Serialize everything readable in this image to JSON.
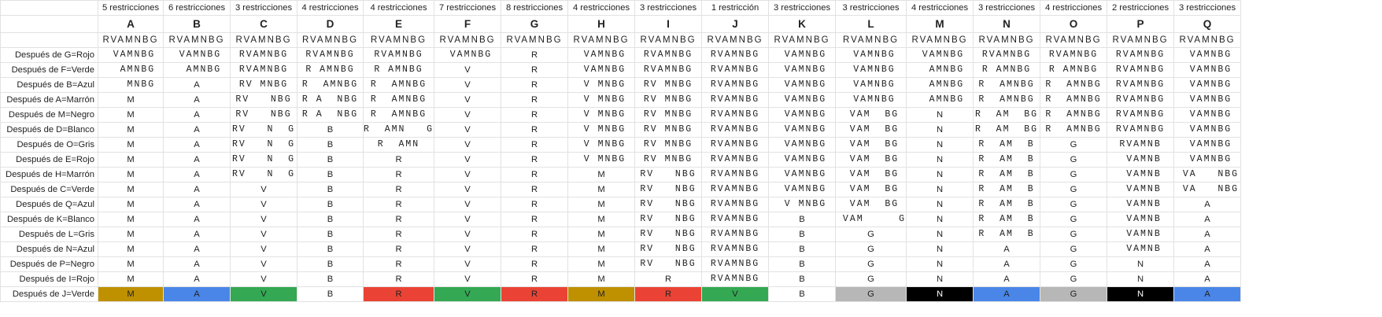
{
  "sheet": {
    "labels_title": "",
    "columns": [
      {
        "count": "5 restricciones",
        "letter": "A"
      },
      {
        "count": "6 restricciones",
        "letter": "B"
      },
      {
        "count": "3 restricciones",
        "letter": "C"
      },
      {
        "count": "4 restricciones",
        "letter": "D"
      },
      {
        "count": "4 restricciones",
        "letter": "E"
      },
      {
        "count": "7 restricciones",
        "letter": "F"
      },
      {
        "count": "8 restricciones",
        "letter": "G"
      },
      {
        "count": "4 restricciones",
        "letter": "H"
      },
      {
        "count": "3 restricciones",
        "letter": "I"
      },
      {
        "count": "1 restricción",
        "letter": "J"
      },
      {
        "count": "3 restricciones",
        "letter": "K"
      },
      {
        "count": "3 restricciones",
        "letter": "L"
      },
      {
        "count": "4 restricciones",
        "letter": "M"
      },
      {
        "count": "3 restricciones",
        "letter": "N"
      },
      {
        "count": "4 restricciones",
        "letter": "O"
      },
      {
        "count": "2 restricciones",
        "letter": "P"
      },
      {
        "count": "3 restricciones",
        "letter": "Q"
      }
    ],
    "options_row": [
      "RVAMNBG",
      "RVAMNBG",
      "RVAMNBG",
      "RVAMNBG",
      "RVAMNBG",
      "RVAMNBG",
      "RVAMNBG",
      "RVAMNBG",
      "RVAMNBG",
      "RVAMNBG",
      "RVAMNBG",
      "RVAMNBG",
      "RVAMNBG",
      "RVAMNBG",
      "RVAMNBG",
      "RVAMNBG",
      "RVAMNBG"
    ],
    "rows": [
      {
        "label": "Después de G=Rojo",
        "cells": [
          " VAMNBG",
          " VAMNBG",
          "RVAMNBG",
          "RVAMNBG",
          "RVAMNBG",
          " VAMNBG",
          "R",
          " VAMNBG",
          "RVAMNBG",
          "RVAMNBG",
          " VAMNBG",
          " VAMNBG",
          " VAMNBG",
          "RVAMNBG",
          "RVAMNBG",
          "RVAMNBG",
          " VAMNBG"
        ]
      },
      {
        "label": "Después de F=Verde",
        "cells": [
          "  AMNBG",
          "  AMNBG",
          "RVAMNBG",
          "R AMNBG",
          "R AMNBG",
          "V",
          "R",
          " VAMNBG",
          "RVAMNBG",
          "RVAMNBG",
          " VAMNBG",
          " VAMNBG",
          "  AMNBG",
          "R AMNBG",
          "R AMNBG",
          "RVAMNBG",
          " VAMNBG"
        ]
      },
      {
        "label": "Después de B=Azul",
        "cells": [
          "   MNBG",
          "A",
          "RV MNBG",
          "R  AMNBG",
          "R  AMNBG",
          "V",
          "R",
          " V MNBG",
          "RV MNBG",
          "RVAMNBG",
          " VAMNBG",
          " VAMNBG",
          "  AMNBG",
          "R  AMNBG",
          "R  AMNBG",
          "RVAMNBG",
          " VAMNBG"
        ]
      },
      {
        "label": "Después de A=Marrón",
        "cells": [
          "M",
          "A",
          "RV   NBG",
          "R A  NBG",
          "R  AMNBG",
          "V",
          "R",
          " V MNBG",
          "RV MNBG",
          "RVAMNBG",
          " VAMNBG",
          " VAMNBG",
          "  AMNBG",
          "R  AMNBG",
          "R  AMNBG",
          "RVAMNBG",
          " VAMNBG"
        ]
      },
      {
        "label": "Después de M=Negro",
        "cells": [
          "M",
          "A",
          "RV   NBG",
          "R A  NBG",
          "R  AMNBG",
          "V",
          "R",
          " V MNBG",
          "RV MNBG",
          "RVAMNBG",
          " VAMNBG",
          " VAM  BG",
          "N",
          "R  AM  BG",
          "R  AMNBG",
          "RVAMNBG",
          " VAMNBG"
        ]
      },
      {
        "label": "Después de D=Blanco",
        "cells": [
          "M",
          "A",
          "RV   N  G",
          "B",
          "R  AMN   G",
          "V",
          "R",
          " V MNBG",
          "RV MNBG",
          "RVAMNBG",
          " VAMNBG",
          " VAM  BG",
          "N",
          "R  AM  BG",
          "R  AMNBG",
          "RVAMNBG",
          " VAMNBG"
        ]
      },
      {
        "label": "Después de O=Gris",
        "cells": [
          "M",
          "A",
          "RV   N  G",
          "B",
          "R  AMN",
          "V",
          "R",
          " V MNBG",
          "RV MNBG",
          "RVAMNBG",
          " VAMNBG",
          " VAM  BG",
          "N",
          "R  AM  B",
          "G",
          "RVAMNB",
          " VAMNBG"
        ]
      },
      {
        "label": "Después de E=Rojo",
        "cells": [
          "M",
          "A",
          "RV   N  G",
          "B",
          "R",
          "V",
          "R",
          " V MNBG",
          "RV MNBG",
          "RVAMNBG",
          " VAMNBG",
          " VAM  BG",
          "N",
          "R  AM  B",
          "G",
          " VAMNB",
          " VAMNBG"
        ]
      },
      {
        "label": "Después de H=Marrón",
        "cells": [
          "M",
          "A",
          "RV   N  G",
          "B",
          "R",
          "V",
          "R",
          "M",
          "RV   NBG",
          "RVAMNBG",
          " VAMNBG",
          " VAM  BG",
          "N",
          "R  AM  B",
          "G",
          " VAMNB",
          " VA   NBG"
        ]
      },
      {
        "label": "Después de C=Verde",
        "cells": [
          "M",
          "A",
          "V",
          "B",
          "R",
          "V",
          "R",
          "M",
          "RV   NBG",
          "RVAMNBG",
          " VAMNBG",
          " VAM  BG",
          "N",
          "R  AM  B",
          "G",
          " VAMNB",
          " VA   NBG"
        ]
      },
      {
        "label": "Después de Q=Azul",
        "cells": [
          "M",
          "A",
          "V",
          "B",
          "R",
          "V",
          "R",
          "M",
          "RV   NBG",
          "RVAMNBG",
          " V MNBG",
          " VAM  BG",
          "N",
          "R  AM  B",
          "G",
          " VAMNB",
          "A"
        ]
      },
      {
        "label": "Después de K=Blanco",
        "cells": [
          "M",
          "A",
          "V",
          "B",
          "R",
          "V",
          "R",
          "M",
          "RV   NBG",
          "RVAMNBG",
          "B",
          " VAM     G",
          "N",
          "R  AM  B",
          "G",
          " VAMNB",
          "A"
        ]
      },
      {
        "label": "Después de L=Gris",
        "cells": [
          "M",
          "A",
          "V",
          "B",
          "R",
          "V",
          "R",
          "M",
          "RV   NBG",
          "RVAMNBG",
          "B",
          "G",
          "N",
          "R  AM  B",
          "G",
          " VAMNB",
          "A"
        ]
      },
      {
        "label": "Después de N=Azul",
        "cells": [
          "M",
          "A",
          "V",
          "B",
          "R",
          "V",
          "R",
          "M",
          "RV   NBG",
          "RVAMNBG",
          "B",
          "G",
          "N",
          "A",
          "G",
          " VAMNB",
          "A"
        ]
      },
      {
        "label": "Después de P=Negro",
        "cells": [
          "M",
          "A",
          "V",
          "B",
          "R",
          "V",
          "R",
          "M",
          "RV   NBG",
          "RVAMNBG",
          "B",
          "G",
          "N",
          "A",
          "G",
          "N",
          "A"
        ]
      },
      {
        "label": "Después de I=Rojo",
        "cells": [
          "M",
          "A",
          "V",
          "B",
          "R",
          "V",
          "R",
          "M",
          "R",
          "RVAMNBG",
          "B",
          "G",
          "N",
          "A",
          "G",
          "N",
          "A"
        ]
      },
      {
        "label": "Después de J=Verde",
        "cells": [
          "M",
          "A",
          "V",
          "B",
          "R",
          "V",
          "R",
          "M",
          "R",
          "V",
          "B",
          "G",
          "N",
          "A",
          "G",
          "N",
          "A"
        ]
      }
    ],
    "final_colors": {
      "M": "#bf9000",
      "A": "#4a86e8",
      "V": "#34a853",
      "R": "#ea4335",
      "G": "#b7b7b7",
      "N": "#000000",
      "B": "#ffffff"
    }
  }
}
